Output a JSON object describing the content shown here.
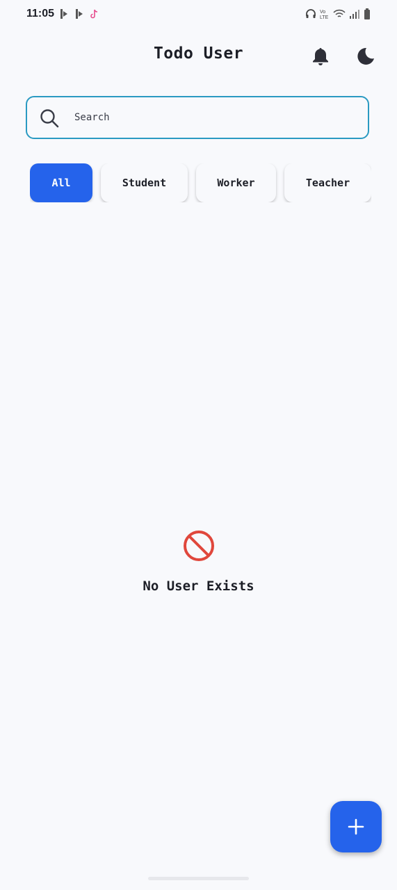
{
  "status_bar": {
    "time": "11:05"
  },
  "app_bar": {
    "title": "Todo User",
    "icons": [
      "bell-icon",
      "moon-icon"
    ]
  },
  "search": {
    "placeholder": "Search",
    "value": ""
  },
  "filters": {
    "items": [
      {
        "label": "All",
        "active": true
      },
      {
        "label": "Student",
        "active": false
      },
      {
        "label": "Worker",
        "active": false
      },
      {
        "label": "Teacher",
        "active": false
      }
    ]
  },
  "empty_state": {
    "message": "No User Exists",
    "icon": "block-icon",
    "icon_color": "#e0473c"
  },
  "fab": {
    "icon": "plus-icon"
  },
  "colors": {
    "accent": "#2563eb",
    "search_border": "#2a9ac2",
    "background": "#f8f9fc"
  }
}
